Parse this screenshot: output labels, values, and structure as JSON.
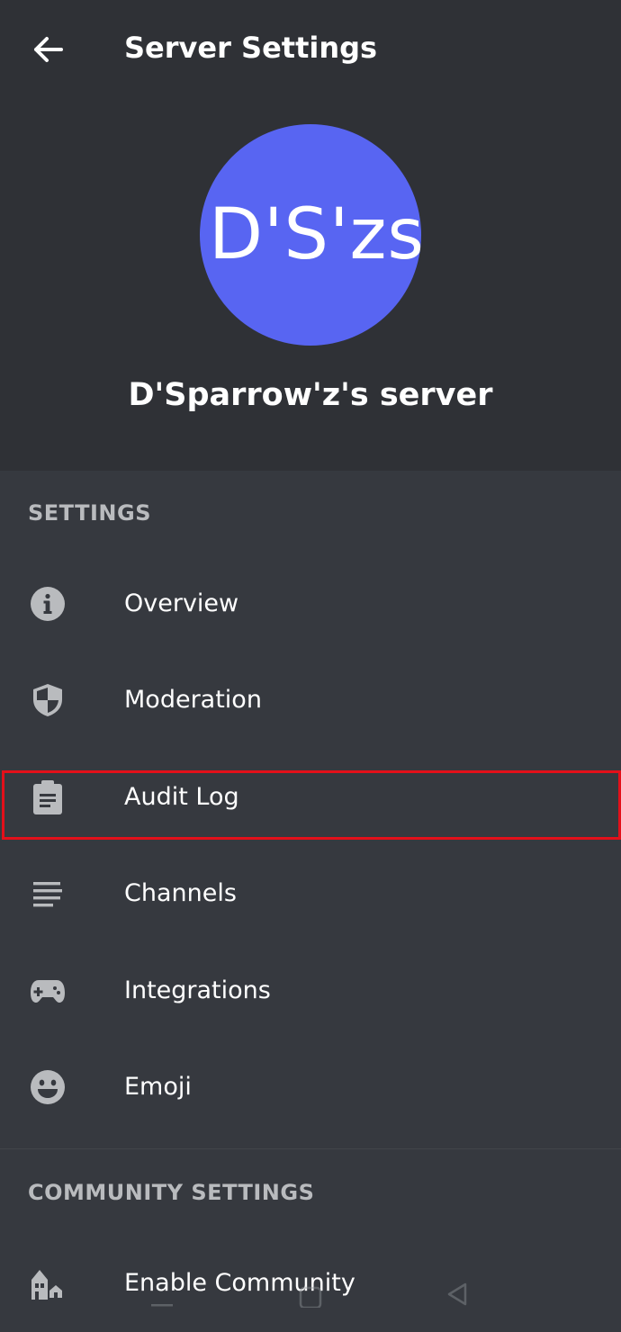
{
  "header": {
    "title": "Server Settings",
    "back_icon": "arrow-left-icon"
  },
  "server": {
    "avatar_initials": "D'S'zs",
    "name": "D'Sparrow'z's server",
    "avatar_color": "#5865f2"
  },
  "sections": {
    "settings": {
      "title": "SETTINGS",
      "items": [
        {
          "label": "Overview",
          "icon": "info-icon"
        },
        {
          "label": "Moderation",
          "icon": "shield-icon"
        },
        {
          "label": "Audit Log",
          "icon": "clipboard-icon",
          "highlighted": true
        },
        {
          "label": "Channels",
          "icon": "text-lines-icon"
        },
        {
          "label": "Integrations",
          "icon": "gamepad-icon"
        },
        {
          "label": "Emoji",
          "icon": "smiley-icon"
        }
      ]
    },
    "community": {
      "title": "COMMUNITY SETTINGS",
      "items": [
        {
          "label": "Enable Community",
          "icon": "community-icon"
        }
      ]
    }
  },
  "colors": {
    "background": "#36393f",
    "header_background": "#2f3136",
    "highlight_border": "#e3101a"
  },
  "system_nav": {
    "icons": [
      "recents-icon",
      "home-icon",
      "back-triangle-icon"
    ]
  }
}
